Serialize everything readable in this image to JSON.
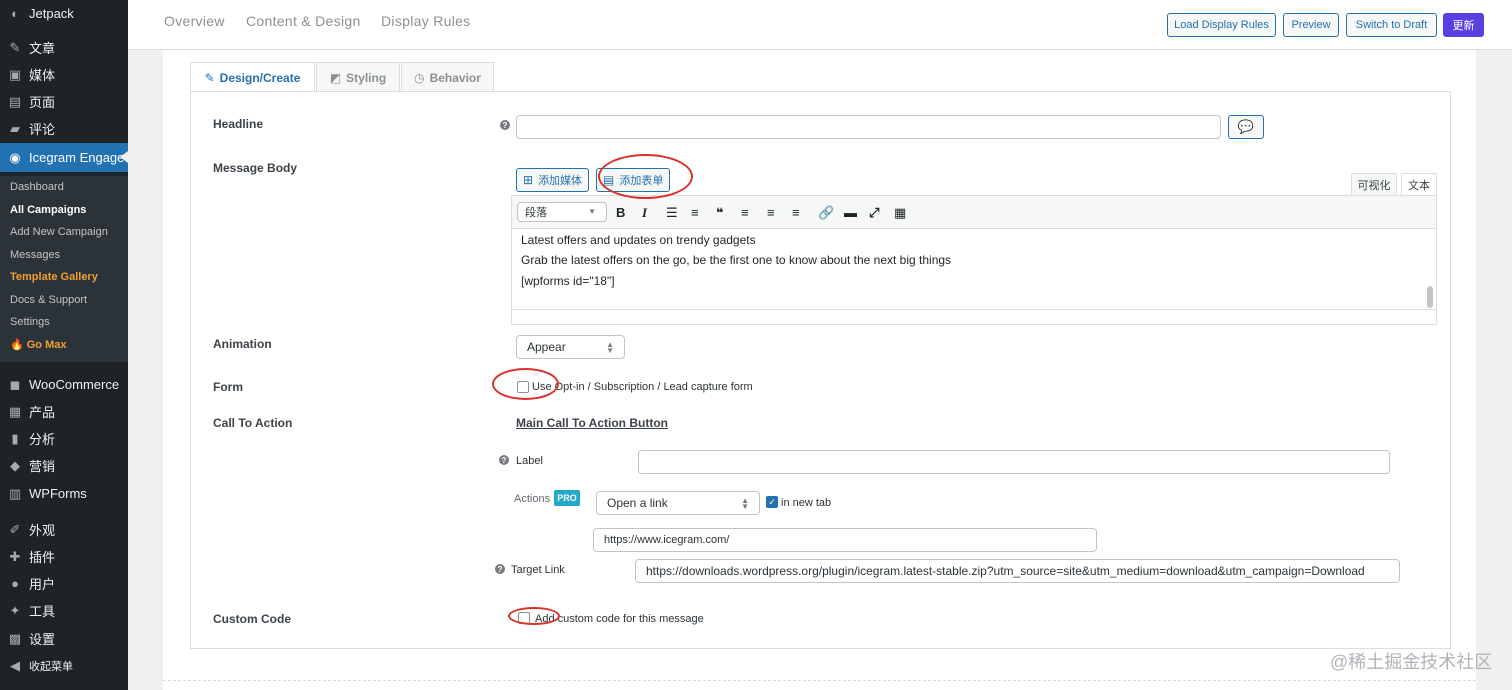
{
  "sidebar": {
    "items": [
      {
        "icon": "jetpack-icon",
        "glyph": "◐",
        "label": "Jetpack"
      },
      {
        "icon": "pin-icon",
        "glyph": "✎",
        "label": "文章"
      },
      {
        "icon": "media-icon",
        "glyph": "▣",
        "label": "媒体"
      },
      {
        "icon": "page-icon",
        "glyph": "▤",
        "label": "页面"
      },
      {
        "icon": "comment-icon",
        "glyph": "▰",
        "label": "评论"
      },
      {
        "icon": "icegram-icon",
        "glyph": "◉",
        "label": "Icegram Engage"
      },
      {
        "icon": "woocommerce-icon",
        "glyph": "◼",
        "label": "WooCommerce"
      },
      {
        "icon": "product-icon",
        "glyph": "▦",
        "label": "产品"
      },
      {
        "icon": "analytics-icon",
        "glyph": "▮",
        "label": "分析"
      },
      {
        "icon": "marketing-icon",
        "glyph": "◆",
        "label": "营销"
      },
      {
        "icon": "wpforms-icon",
        "glyph": "▥",
        "label": "WPForms"
      },
      {
        "icon": "appearance-icon",
        "glyph": "✐",
        "label": "外观"
      },
      {
        "icon": "plugins-icon",
        "glyph": "✚",
        "label": "插件"
      },
      {
        "icon": "users-icon",
        "glyph": "●",
        "label": "用户"
      },
      {
        "icon": "tools-icon",
        "glyph": "✦",
        "label": "工具"
      },
      {
        "icon": "settings-icon",
        "glyph": "▩",
        "label": "设置"
      },
      {
        "icon": "collapse-icon",
        "glyph": "◀",
        "label": "收起菜单"
      }
    ],
    "submenu": [
      "Dashboard",
      "All Campaigns",
      "Add New Campaign",
      "Messages",
      "Template Gallery",
      "Docs & Support",
      "Settings",
      "🔥 Go Max"
    ]
  },
  "topbar": {
    "tabs": [
      "Overview",
      "Content & Design",
      "Display Rules"
    ],
    "buttons": {
      "load": "Load Display Rules",
      "preview": "Preview",
      "draft": "Switch to Draft",
      "update": "更新"
    }
  },
  "subtabs": [
    "Design/Create",
    "Styling",
    "Behavior"
  ],
  "form": {
    "headline_label": "Headline",
    "headline_value": "",
    "body_label": "Message Body",
    "add_media": "添加媒体",
    "add_form": "添加表单",
    "mode_visual": "可视化",
    "mode_text": "文本",
    "format_select": "段落",
    "body_lines": [
      "Latest offers and updates on trendy gadgets",
      "Grab the latest offers on the go, be the first one to know about the next big things",
      "[wpforms id=\"18\"]"
    ],
    "animation_label": "Animation",
    "animation_value": "Appear",
    "form_label": "Form",
    "form_checkbox": "Use Opt-in / Subscription / Lead capture form",
    "cta_label": "Call To Action",
    "cta_link": "Main Call To Action Button",
    "label_label": "Label",
    "label_value": "",
    "actions_label": "Actions",
    "pro_badge": "PRO",
    "action_value": "Open a link",
    "new_tab": "in new tab",
    "action_url": "https://www.icegram.com/",
    "target_label": "Target Link",
    "target_value": "https://downloads.wordpress.org/plugin/icegram.latest-stable.zip?utm_source=site&utm_medium=download&utm_campaign=Download",
    "custom_code_label": "Custom Code",
    "custom_code_checkbox": "Add custom code for this message"
  },
  "watermark": "@稀土掘金技术社区",
  "colors": {
    "accent": "#2271b1",
    "update_button": "#5b3fe0",
    "highlight": "#d9312b"
  }
}
